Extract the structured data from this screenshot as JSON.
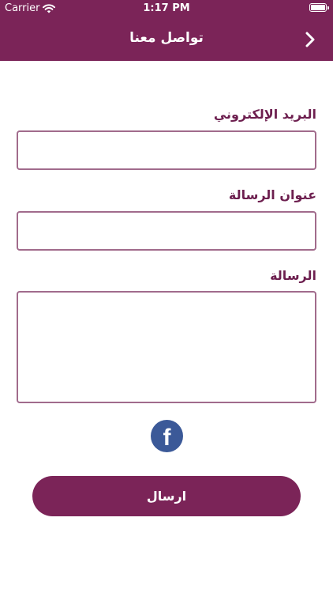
{
  "status_bar": {
    "carrier": "Carrier",
    "time": "1:17 PM"
  },
  "header": {
    "title": "تواصل معنا",
    "back_icon": "chevron-right-icon",
    "background_color": "#7b2458"
  },
  "form": {
    "email_label": "البريد الإلكتروني",
    "email_value": "",
    "subject_label": "عنوان الرسالة",
    "subject_value": "",
    "message_label": "الرسالة",
    "message_value": ""
  },
  "social": {
    "facebook_icon": "facebook-icon",
    "facebook_glyph": "f",
    "facebook_color": "#3b5998"
  },
  "actions": {
    "send_label": "ارسال",
    "accent_color": "#7b2458"
  }
}
